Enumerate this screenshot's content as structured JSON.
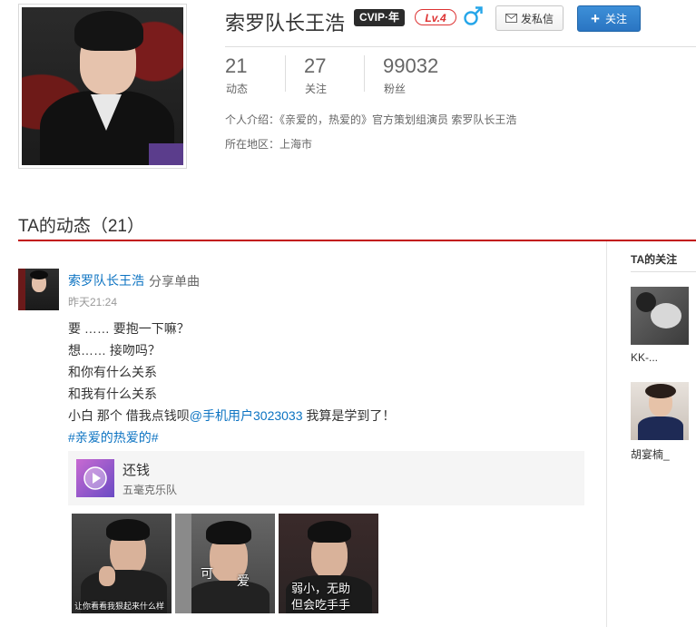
{
  "profile": {
    "username": "索罗队长王浩",
    "vip_label": "CVIP·年",
    "level_label": "Lv.4",
    "gender_icon": "male-icon",
    "message_button": "发私信",
    "follow_button": "关注",
    "stats": [
      {
        "value": "21",
        "label": "动态"
      },
      {
        "value": "27",
        "label": "关注"
      },
      {
        "value": "99032",
        "label": "粉丝"
      }
    ],
    "intro_label": "个人介绍：",
    "intro_text": "《亲爱的，热爱的》官方策划组演员 索罗队长王浩",
    "location_label": "所在地区：",
    "location_text": "上海市"
  },
  "feed": {
    "section_title": "TA的动态（21）",
    "post": {
      "author": "索罗队长王浩",
      "action": "分享单曲",
      "time": "昨天21:24",
      "lines": [
        "要 …… 要抱一下嘛？",
        "想…… 接吻吗？",
        "和你有什么关系",
        "和我有什么关系"
      ],
      "line5_prefix": "小白 那个 借我点钱呗",
      "mention": "@手机用户3023033",
      "line5_suffix": " 我算是学到了！",
      "hashtag": "#亲爱的热爱的#",
      "song": {
        "title": "还钱",
        "artist": "五毫克乐队"
      },
      "images": [
        {
          "caption": "让你看看我狠起来什么样"
        },
        {
          "caption_left": "可",
          "caption_right": "爱"
        },
        {
          "caption_line1": "弱小，无助",
          "caption_line2": "但会吃手手"
        }
      ]
    }
  },
  "sidebar": {
    "title": "TA的关注",
    "follows": [
      {
        "name": "KK-..."
      },
      {
        "name": "胡宴楠_"
      }
    ]
  },
  "colors": {
    "accent_red": "#c20c0c",
    "link_blue": "#0c73c2",
    "follow_blue": "#2a75c2"
  }
}
